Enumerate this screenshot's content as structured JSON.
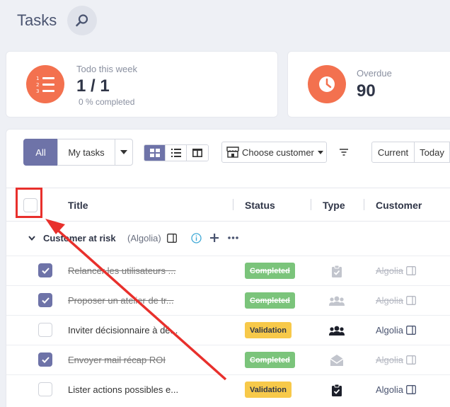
{
  "app": {
    "title": "Tasks"
  },
  "stats": {
    "todo": {
      "label": "Todo this week",
      "value": "1 / 1",
      "sub": "0 % completed"
    },
    "overdue": {
      "label": "Overdue",
      "value": "90"
    }
  },
  "toolbar": {
    "filter_all": "All",
    "filter_mytasks": "My tasks",
    "choose_customer": "Choose customer",
    "period_current": "Current",
    "period_today": "Today"
  },
  "table": {
    "columns": {
      "title": "Title",
      "status": "Status",
      "type": "Type",
      "customer": "Customer"
    },
    "group": {
      "title": "Customer at risk",
      "customer": "(Algolia)"
    },
    "rows": [
      {
        "title": "Relancer les utilisateurs ...",
        "status": "Completed",
        "type_icon": "clipboard-check-icon",
        "customer": "Algolia",
        "done": true
      },
      {
        "title": "Proposer un atelier de tr...",
        "status": "Completed",
        "type_icon": "users-icon",
        "customer": "Algolia",
        "done": true
      },
      {
        "title": "Inviter décisionnaire à dé...",
        "status": "Validation",
        "type_icon": "users-icon",
        "customer": "Algolia",
        "done": false
      },
      {
        "title": "Envoyer mail récap ROI",
        "status": "Completed",
        "type_icon": "envelope-open-icon",
        "customer": "Algolia",
        "done": true
      },
      {
        "title": "Lister actions possibles e...",
        "status": "Validation",
        "type_icon": "clipboard-check-icon",
        "customer": "Algolia",
        "done": false
      }
    ]
  },
  "colors": {
    "accent": "#6e73a8",
    "orange": "#f3714f",
    "completed": "#7bc47b",
    "validation": "#f7c94a",
    "annotation": "#e8302c"
  }
}
